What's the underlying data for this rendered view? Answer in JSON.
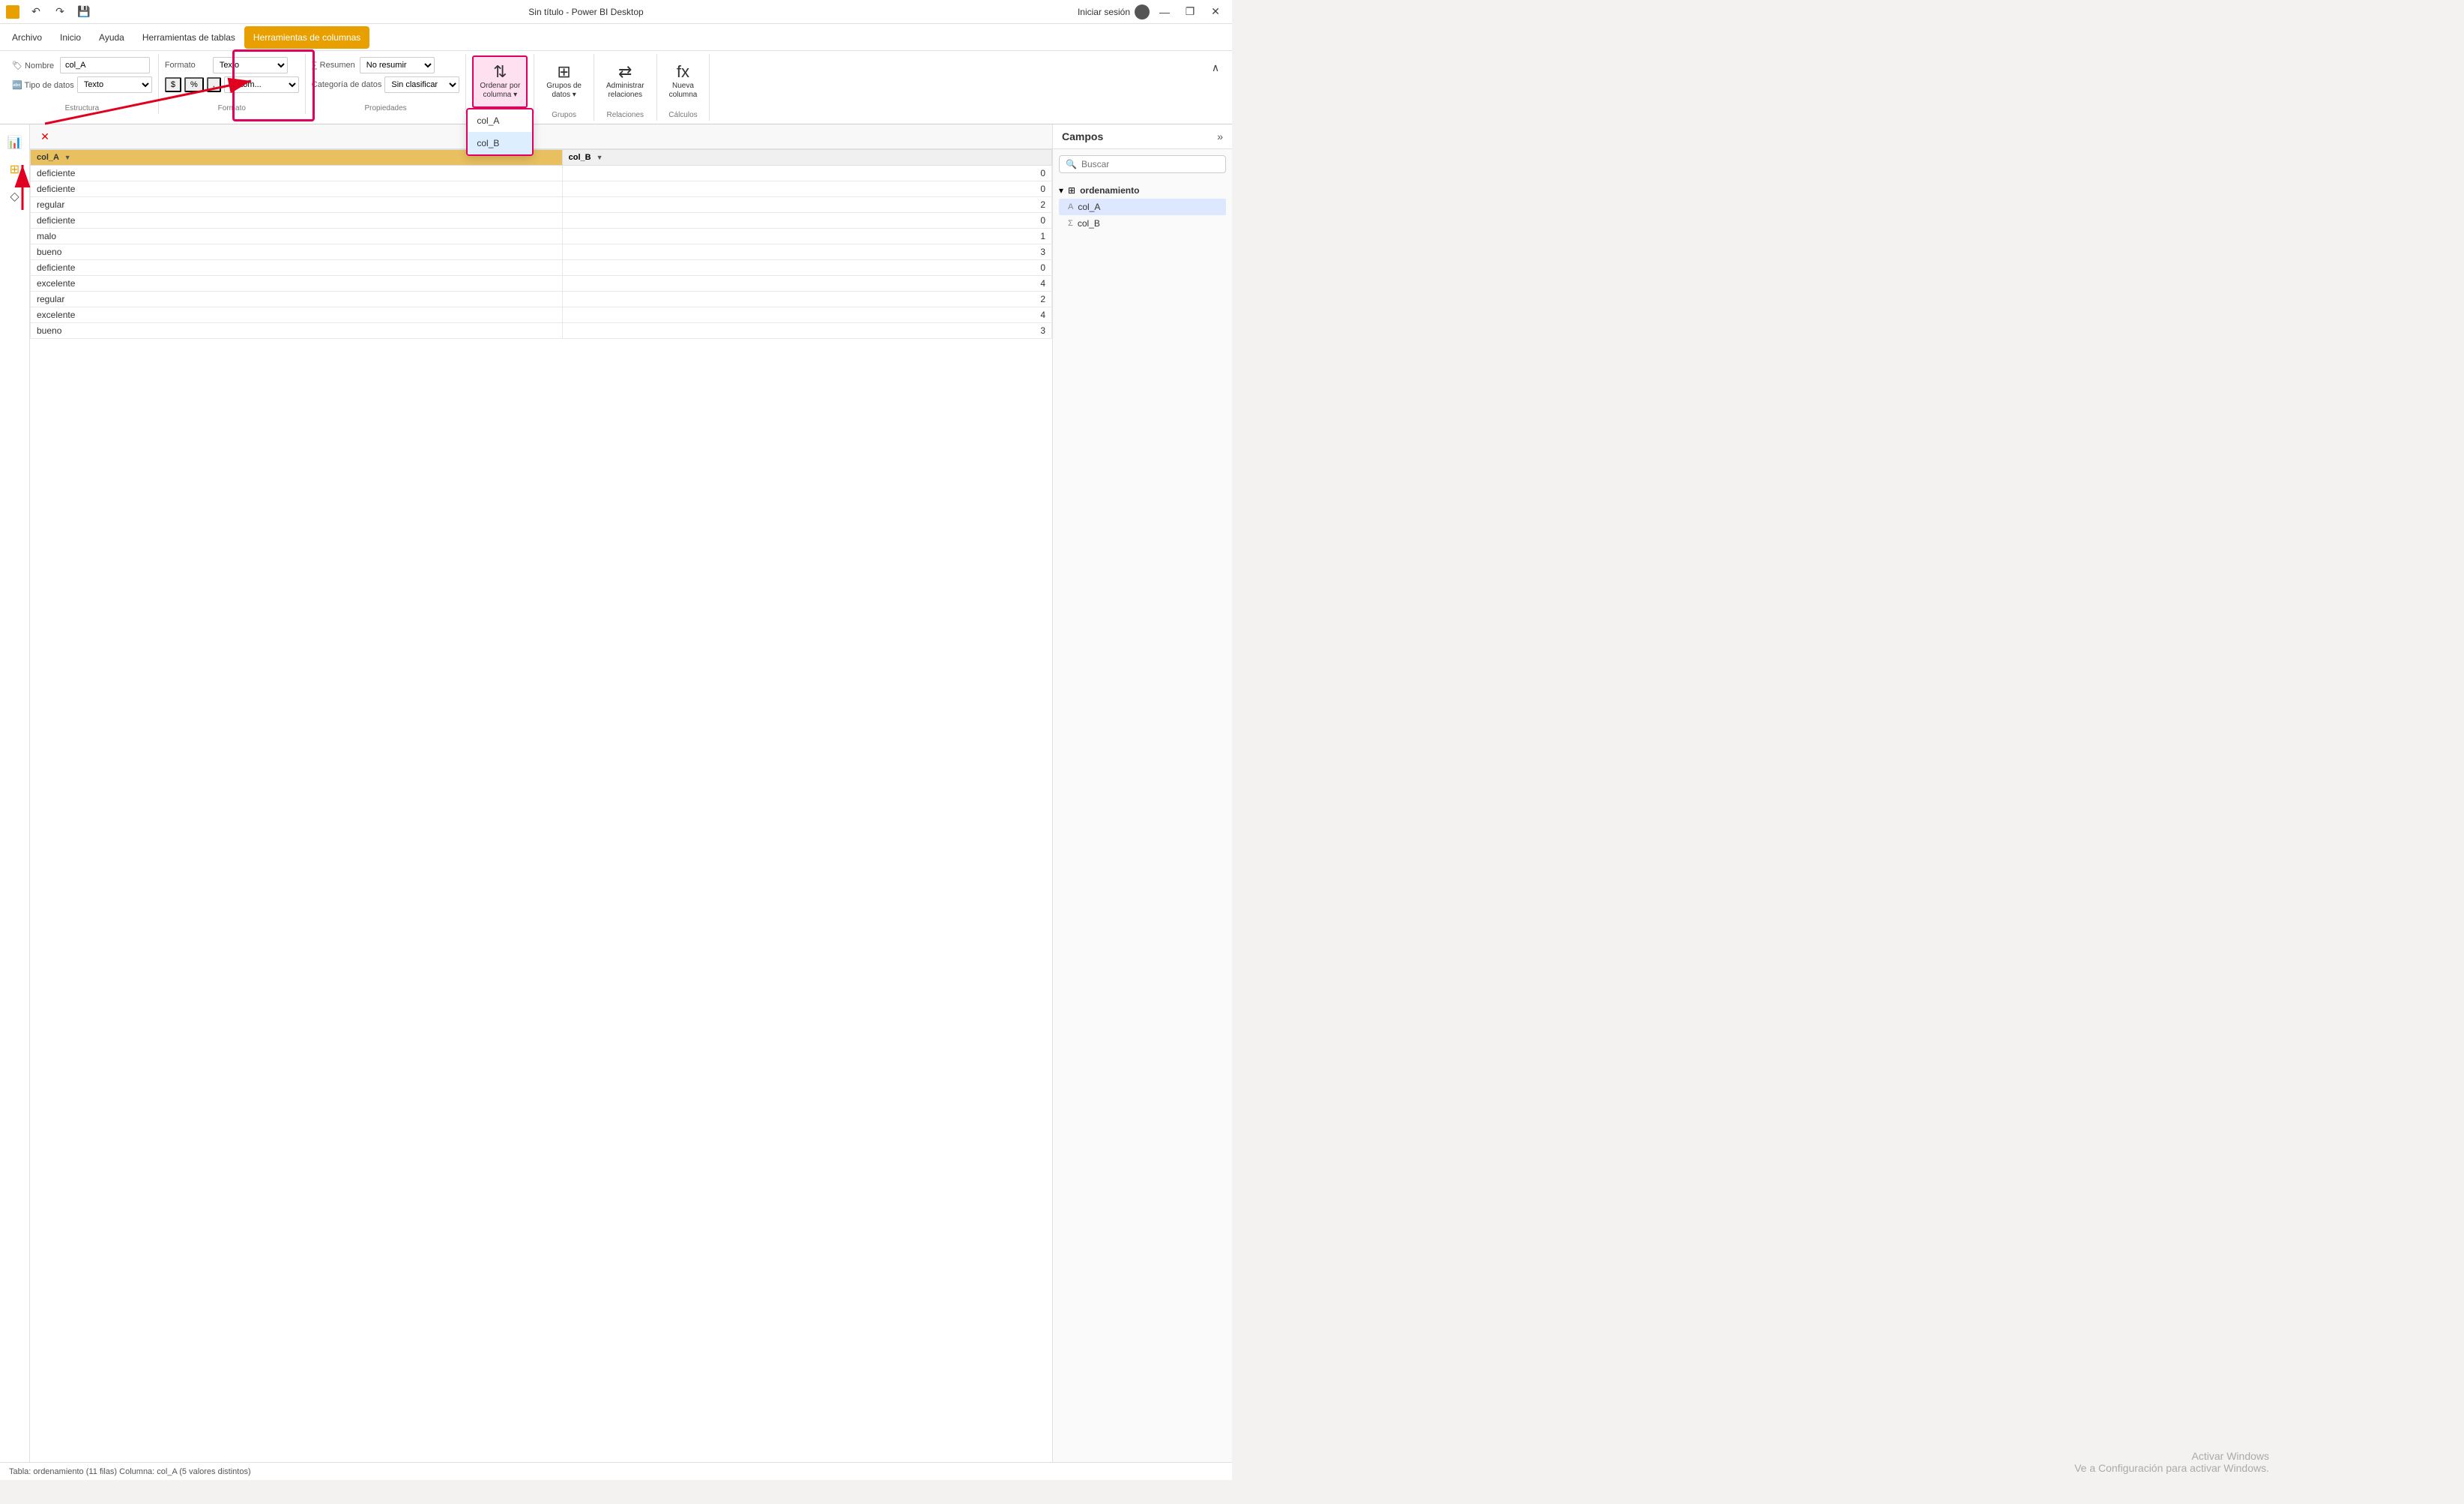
{
  "titlebar": {
    "title": "Sin título - Power BI Desktop",
    "signin": "Iniciar sesión",
    "controls": {
      "minimize": "—",
      "maximize": "❐",
      "close": "✕"
    }
  },
  "menubar": {
    "items": [
      {
        "id": "archivo",
        "label": "Archivo"
      },
      {
        "id": "inicio",
        "label": "Inicio"
      },
      {
        "id": "ayuda",
        "label": "Ayuda"
      },
      {
        "id": "herramientas-tablas",
        "label": "Herramientas de tablas"
      },
      {
        "id": "herramientas-columnas",
        "label": "Herramientas de columnas",
        "active": true
      }
    ]
  },
  "ribbon": {
    "groups": [
      {
        "id": "estructura",
        "label": "Estructura",
        "items": [
          {
            "type": "field",
            "label": "Nombre",
            "value": "col_A"
          },
          {
            "type": "field",
            "label": "Tipo de datos",
            "value": "Texto"
          }
        ]
      },
      {
        "id": "formato",
        "label": "Formato",
        "items": [
          {
            "type": "select",
            "label": "Formato",
            "value": "Texto"
          },
          {
            "type": "select",
            "label": "",
            "value": "No resumir"
          },
          {
            "type": "buttons",
            "labels": [
              "$",
              "%",
              ",",
              "Autom..."
            ]
          }
        ]
      },
      {
        "id": "propiedades",
        "label": "Propiedades",
        "items": [
          {
            "type": "row",
            "label": "Resumen",
            "select": "No resumir"
          },
          {
            "type": "row",
            "label": "Categoría de datos",
            "select": "Sin clasificar"
          }
        ]
      },
      {
        "id": "orden",
        "label": "",
        "btn_label": "Ordenar por\ncolumna",
        "btn_icon": "⇅",
        "highlighted": true,
        "dropdown": {
          "items": [
            {
              "id": "col_a",
              "label": "col_A"
            },
            {
              "id": "col_b",
              "label": "col_B",
              "selected": true
            }
          ]
        }
      },
      {
        "id": "grupos",
        "label": "Grupos",
        "btn_label": "Grupos de\ndatos",
        "btn_icon": "⊞"
      },
      {
        "id": "relaciones",
        "label": "Relaciones",
        "btn_label": "Administrar\nrelaciones",
        "btn_icon": "🔗"
      },
      {
        "id": "calculos",
        "label": "Cálculos",
        "btn_label": "Nueva\ncolumna",
        "btn_icon": "fx"
      }
    ]
  },
  "table": {
    "col_a_header": "col_A",
    "col_b_header": "col_B",
    "rows": [
      {
        "col_a": "deficiente",
        "col_b": "0"
      },
      {
        "col_a": "deficiente",
        "col_b": "0"
      },
      {
        "col_a": "regular",
        "col_b": "2"
      },
      {
        "col_a": "deficiente",
        "col_b": "0"
      },
      {
        "col_a": "malo",
        "col_b": "1"
      },
      {
        "col_a": "bueno",
        "col_b": "3"
      },
      {
        "col_a": "deficiente",
        "col_b": "0"
      },
      {
        "col_a": "excelente",
        "col_b": "4"
      },
      {
        "col_a": "regular",
        "col_b": "2"
      },
      {
        "col_a": "excelente",
        "col_b": "4"
      },
      {
        "col_a": "bueno",
        "col_b": "3"
      }
    ]
  },
  "fields_panel": {
    "title": "Campos",
    "search_placeholder": "Buscar",
    "section": {
      "label": "ordenamiento",
      "icon": "⊞",
      "fields": [
        {
          "id": "col_a",
          "label": "col_A",
          "icon": "A",
          "selected": true
        },
        {
          "id": "col_b",
          "label": "col_B",
          "icon": "Σ"
        }
      ]
    }
  },
  "statusbar": {
    "text": "Tabla: ordenamiento (11 filas) Columna: col_A (5 valores distintos)"
  },
  "watermark": {
    "line1": "Activar Windows",
    "line2": "Ve a Configuración para activar Windows."
  },
  "sort_dropdown": {
    "col_a": "col_A",
    "col_b": "col_B"
  }
}
